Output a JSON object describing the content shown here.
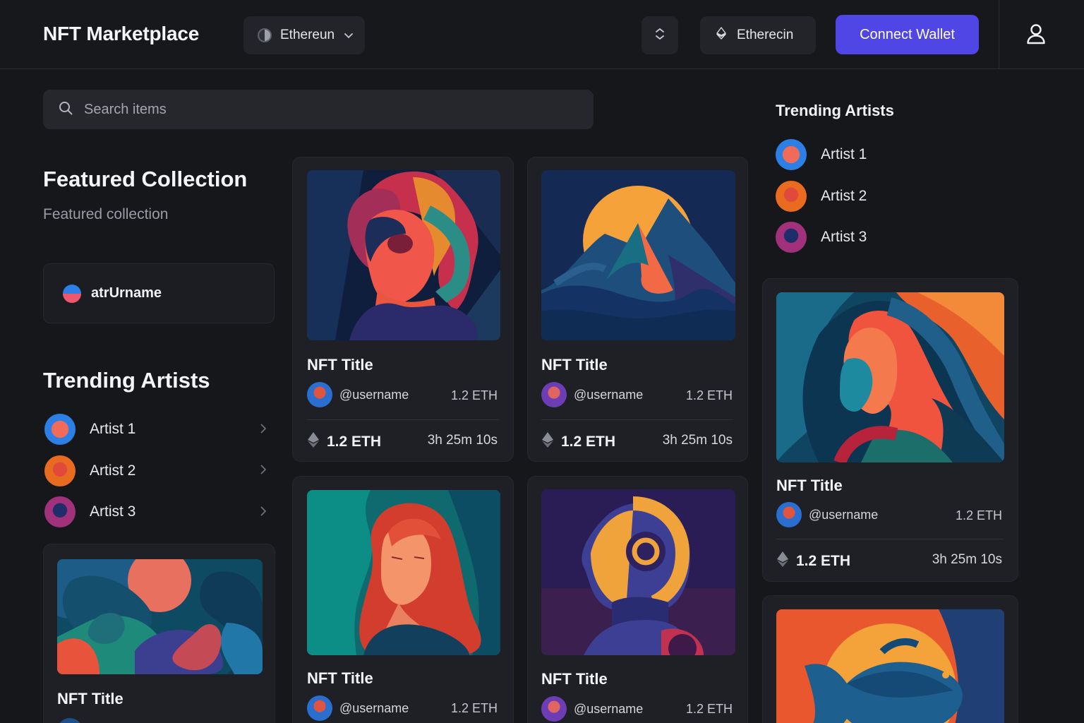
{
  "header": {
    "brand": "NFT Marketplace",
    "network_select": "Ethereun",
    "eth_pill": "Etherecin",
    "connect_label": "Connect Wallet"
  },
  "search": {
    "placeholder": "Search items"
  },
  "featured": {
    "title": "Featured Collection",
    "subtitle": "Featured collection",
    "user_label": "atrUrname"
  },
  "trending_left": {
    "title": "Trending Artists",
    "artists": [
      {
        "name": "Artist 1",
        "avatar": "av-1"
      },
      {
        "name": "Artist 2",
        "avatar": "av-2"
      },
      {
        "name": "Artist 3",
        "avatar": "av-3"
      }
    ]
  },
  "trending_right": {
    "title": "Trending Artists",
    "artists": [
      {
        "name": "Artist 1"
      },
      {
        "name": "Artist 2"
      },
      {
        "name": "Artist 3"
      }
    ]
  },
  "cards": [
    {
      "title": "NFT Title",
      "owner": "@username",
      "price_small": "1.2 ETH",
      "price": "1.2 ETH",
      "timer": "3h 25m 10s"
    },
    {
      "title": "NFT Title",
      "owner": "@username",
      "price_small": "1.2 ETH",
      "price": "1.2 ETH",
      "timer": "3h 25m 10s"
    },
    {
      "title": "NFT Title",
      "owner": "@username",
      "price_small": "1.2 ETH",
      "price": "1.2 ETH",
      "timer": "3h 25m 10s"
    },
    {
      "title": "NFT Title",
      "owner": "@username",
      "price_small": "1.2 ETH"
    },
    {
      "title": "NFT Title",
      "owner": "@username",
      "price_small": "1.2 ETH"
    },
    {
      "title": "NFT Title"
    }
  ],
  "colors": {
    "background": "#16171b",
    "card": "#1f2025",
    "accent": "#4f46e5"
  }
}
